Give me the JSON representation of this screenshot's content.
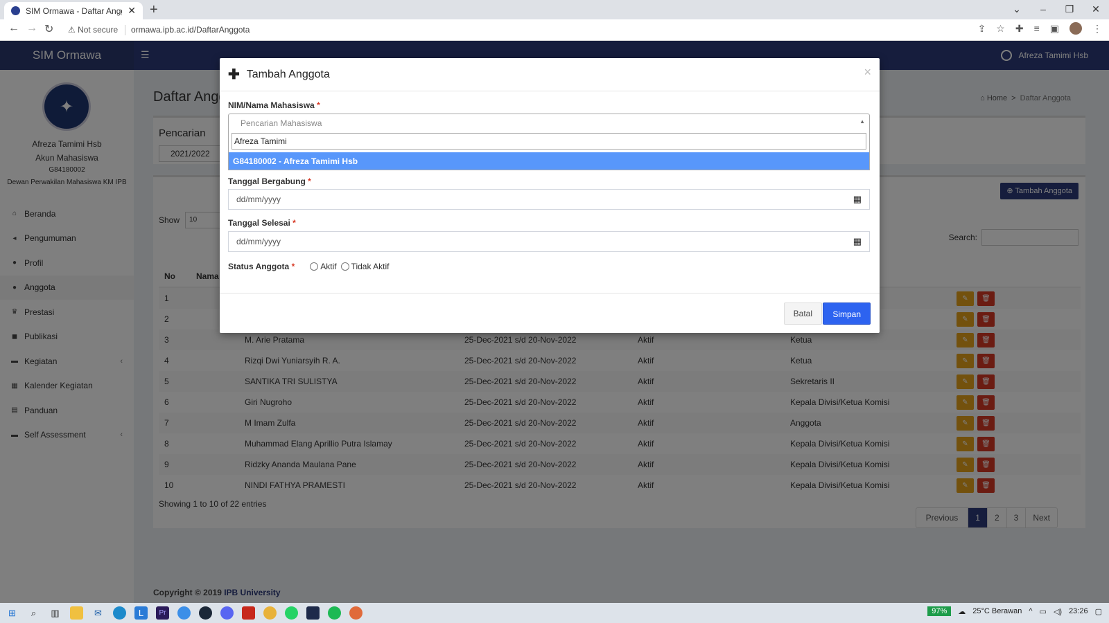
{
  "browser": {
    "tab_title": "SIM Ormawa - Daftar Anggota",
    "security": "Not secure",
    "url": "ormawa.ipb.ac.id/DaftarAnggota"
  },
  "header": {
    "brand": "SIM Ormawa",
    "user": "Afreza Tamimi Hsb"
  },
  "sidebar": {
    "name": "Afreza Tamimi Hsb",
    "role": "Akun Mahasiswa",
    "nim": "G84180002",
    "org": "Dewan Perwakilan Mahasiswa KM IPB",
    "items": [
      {
        "label": "Beranda",
        "icon": "home-icon"
      },
      {
        "label": "Pengumuman",
        "icon": "bullhorn-icon"
      },
      {
        "label": "Profil",
        "icon": "user-icon"
      },
      {
        "label": "Anggota",
        "icon": "users-icon"
      },
      {
        "label": "Prestasi",
        "icon": "trophy-icon"
      },
      {
        "label": "Publikasi",
        "icon": "comments-icon"
      },
      {
        "label": "Kegiatan",
        "icon": "folder-icon"
      },
      {
        "label": "Kalender Kegiatan",
        "icon": "calendar-icon"
      },
      {
        "label": "Panduan",
        "icon": "book-icon"
      },
      {
        "label": "Self Assessment",
        "icon": "folder-icon"
      }
    ]
  },
  "content": {
    "title": "Daftar Angg",
    "breadcrumb_home": "Home",
    "breadcrumb_current": "Daftar Anggota",
    "filter_heading": "Pencarian",
    "year_select": "2021/2022",
    "add_button": "Tambah Anggota",
    "show_label": "Show",
    "show_value": "10",
    "search_label": "Search:",
    "col_no": "No",
    "col_name": "Nama",
    "rows": [
      {
        "no": "1",
        "name": "",
        "period": "",
        "status": "",
        "role": ""
      },
      {
        "no": "2",
        "name": "",
        "period": "",
        "status": "",
        "role": ""
      },
      {
        "no": "3",
        "name": "M. Arie Pratama",
        "period": "25-Dec-2021 s/d 20-Nov-2022",
        "status": "Aktif",
        "role": "Ketua"
      },
      {
        "no": "4",
        "name": "Rizqi Dwi Yuniarsyih R. A.",
        "period": "25-Dec-2021 s/d 20-Nov-2022",
        "status": "Aktif",
        "role": "Ketua"
      },
      {
        "no": "5",
        "name": "SANTIKA TRI SULISTYA",
        "period": "25-Dec-2021 s/d 20-Nov-2022",
        "status": "Aktif",
        "role": "Sekretaris II"
      },
      {
        "no": "6",
        "name": "Giri Nugroho",
        "period": "25-Dec-2021 s/d 20-Nov-2022",
        "status": "Aktif",
        "role": "Kepala Divisi/Ketua Komisi"
      },
      {
        "no": "7",
        "name": "M Imam Zulfa",
        "period": "25-Dec-2021 s/d 20-Nov-2022",
        "status": "Aktif",
        "role": "Anggota"
      },
      {
        "no": "8",
        "name": "Muhammad Elang Aprillio Putra Islamay",
        "period": "25-Dec-2021 s/d 20-Nov-2022",
        "status": "Aktif",
        "role": "Kepala Divisi/Ketua Komisi"
      },
      {
        "no": "9",
        "name": "Ridzky Ananda Maulana Pane",
        "period": "25-Dec-2021 s/d 20-Nov-2022",
        "status": "Aktif",
        "role": "Kepala Divisi/Ketua Komisi"
      },
      {
        "no": "10",
        "name": "NINDI FATHYA PRAMESTI",
        "period": "25-Dec-2021 s/d 20-Nov-2022",
        "status": "Aktif",
        "role": "Kepala Divisi/Ketua Komisi"
      }
    ],
    "entries": "Showing 1 to 10 of 22 entries",
    "pager": [
      "Previous",
      "1",
      "2",
      "3",
      "Next"
    ],
    "footer_text": "Copyright © 2019",
    "footer_link": "IPB University"
  },
  "modal": {
    "title": "Tambah Anggota",
    "nim_label": "NIM/Nama Mahasiswa",
    "required_mark": "*",
    "combo_placeholder": "Pencarian Mahasiswa",
    "search_value": "Afreza Tamimi",
    "option": "G84180002 - Afreza Tamimi Hsb",
    "join_label": "Tanggal Bergabung",
    "end_label": "Tanggal Selesai",
    "date_placeholder": "dd/mm/yyyy",
    "status_label": "Status Anggota",
    "radio_active": "Aktif",
    "radio_inactive": "Tidak Aktif",
    "cancel": "Batal",
    "save": "Simpan"
  },
  "taskbar": {
    "battery": "97%",
    "weather": "25°C  Berawan",
    "time": "23:26"
  },
  "colors": {
    "header": "#2c3b7a",
    "option_highlight": "#5897fb",
    "save_button": "#2d63f0",
    "edit_button": "#e6a21a",
    "delete_button": "#d73925"
  }
}
